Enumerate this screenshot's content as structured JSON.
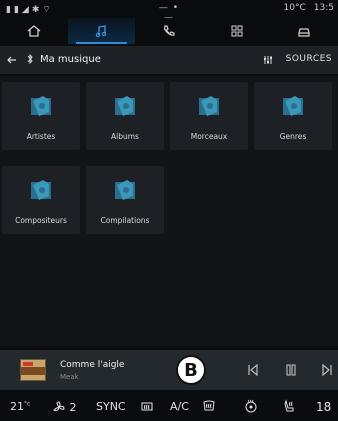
{
  "status_bar": {
    "time_center": "— • —",
    "temperature": "10°C",
    "clock": "13:5"
  },
  "nav_tabs": [
    {
      "icon": "home-icon"
    },
    {
      "icon": "music-note-icon",
      "active": true
    },
    {
      "icon": "phone-icon"
    },
    {
      "icon": "apps-grid-icon"
    },
    {
      "icon": "car-icon"
    }
  ],
  "header": {
    "title": "Ma musique",
    "sources_label": "SOURCES"
  },
  "categories": [
    {
      "label": "Artistes"
    },
    {
      "label": "Albums"
    },
    {
      "label": "Morceaux"
    },
    {
      "label": "Genres"
    },
    {
      "label": "Compositeurs"
    },
    {
      "label": "Compilations"
    }
  ],
  "now_playing": {
    "title": "Comme l'aigle",
    "artist": "Meak",
    "marker": "B"
  },
  "climate": {
    "left_temp": "21",
    "left_unit": "°c",
    "fan_speed": "2",
    "sync_label": "SYNC",
    "ac_label": "A/C",
    "right_temp": "18"
  },
  "colors": {
    "accent": "#2b89d8",
    "tile_bg": "#1d2126",
    "header_bg": "#1e2227"
  }
}
